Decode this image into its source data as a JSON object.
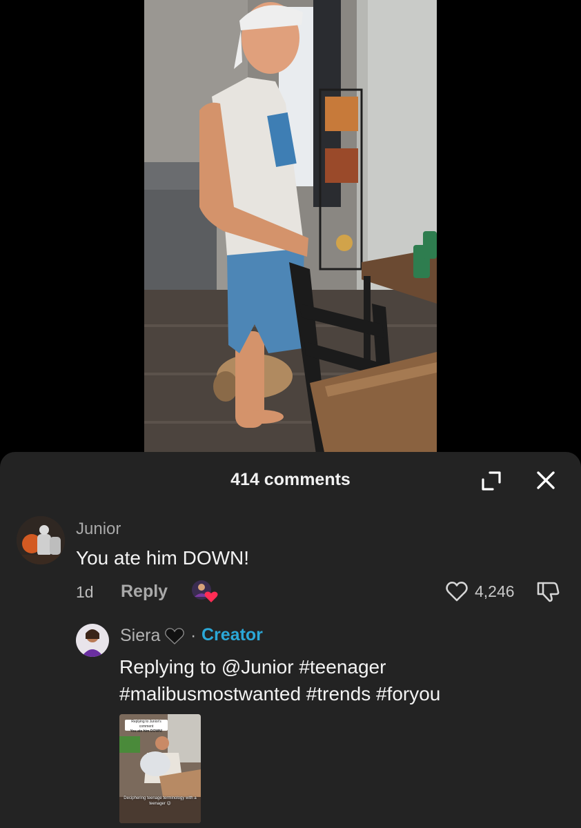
{
  "comments_panel": {
    "title": "414 comments"
  },
  "comment": {
    "username": "Junior",
    "text": "You ate him DOWN!",
    "time": "1d",
    "reply_label": "Reply",
    "like_count": "4,246"
  },
  "reply": {
    "username": "Siera",
    "separator": "·",
    "badge": "Creator",
    "text": "Replying to @Junior #teenager #malibusmostwanted #trends #foryou",
    "thumbnail": {
      "card_line1": "Replying to Junior's comment",
      "card_line2": "You ate him DOWN!",
      "caption": "Deciphering teenage terminology with a teenager 😉"
    }
  },
  "colors": {
    "sheet_background": "#232323",
    "creator_badge": "#2ba8d8",
    "like_heart_badge": "#ff2d55"
  }
}
